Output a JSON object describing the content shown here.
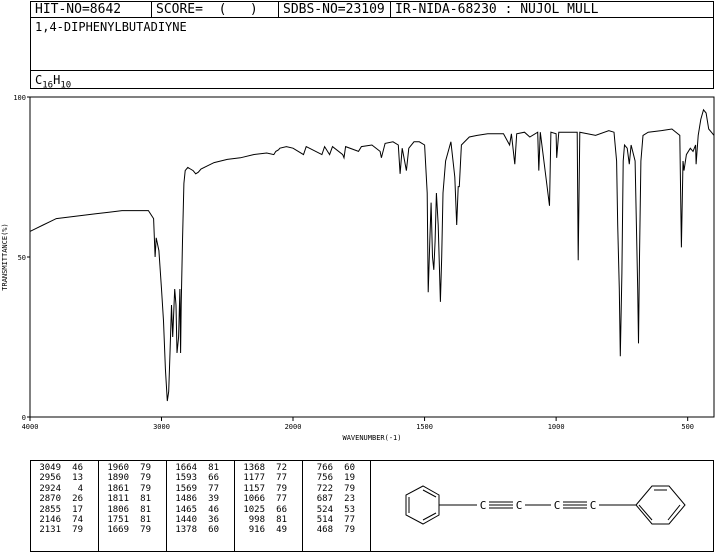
{
  "header": {
    "hit_no": "HIT-NO=8642",
    "score": "SCORE=  (   )",
    "sdbs_no": "SDBS-NO=23109",
    "ir_code": "IR-NIDA-68230 : NUJOL MULL"
  },
  "compound": {
    "name": "1,4-DIPHENYLBUTADIYNE",
    "formula_c": "C",
    "formula_c_sub": "16",
    "formula_h": "H",
    "formula_h_sub": "10"
  },
  "chart_data": {
    "type": "line",
    "xlabel": "WAVENUMBER(-1)",
    "ylabel": "TRANSMITTANCE(%)",
    "xlim": [
      4000,
      400
    ],
    "ylim": [
      0,
      100
    ],
    "x_ticks": [
      4000,
      3000,
      2000,
      1500,
      1000,
      500
    ],
    "y_ticks": [
      0,
      50,
      100
    ],
    "grid": false,
    "series": [
      {
        "points": [
          [
            4000,
            58
          ],
          [
            3950,
            59
          ],
          [
            3900,
            60
          ],
          [
            3850,
            61
          ],
          [
            3800,
            62
          ],
          [
            3700,
            62.5
          ],
          [
            3600,
            63
          ],
          [
            3500,
            63.5
          ],
          [
            3400,
            64
          ],
          [
            3300,
            64.5
          ],
          [
            3200,
            64.5
          ],
          [
            3100,
            64.5
          ],
          [
            3060,
            62
          ],
          [
            3049,
            50
          ],
          [
            3040,
            56
          ],
          [
            3020,
            52
          ],
          [
            3000,
            40
          ],
          [
            2985,
            30
          ],
          [
            2970,
            15
          ],
          [
            2956,
            5
          ],
          [
            2945,
            8
          ],
          [
            2935,
            20
          ],
          [
            2924,
            35
          ],
          [
            2915,
            25
          ],
          [
            2900,
            40
          ],
          [
            2890,
            35
          ],
          [
            2882,
            20
          ],
          [
            2870,
            25
          ],
          [
            2860,
            40
          ],
          [
            2855,
            20
          ],
          [
            2850,
            35
          ],
          [
            2840,
            55
          ],
          [
            2830,
            73
          ],
          [
            2820,
            77
          ],
          [
            2800,
            78
          ],
          [
            2780,
            77.5
          ],
          [
            2760,
            77
          ],
          [
            2740,
            76
          ],
          [
            2720,
            76.5
          ],
          [
            2700,
            77.5
          ],
          [
            2650,
            78.5
          ],
          [
            2600,
            79.5
          ],
          [
            2500,
            80.5
          ],
          [
            2400,
            81
          ],
          [
            2300,
            82
          ],
          [
            2200,
            82.5
          ],
          [
            2146,
            82
          ],
          [
            2131,
            83
          ],
          [
            2110,
            83.5
          ],
          [
            2100,
            84
          ],
          [
            2050,
            84.5
          ],
          [
            2000,
            84
          ],
          [
            1960,
            82
          ],
          [
            1950,
            84.5
          ],
          [
            1890,
            82
          ],
          [
            1880,
            84.5
          ],
          [
            1861,
            82
          ],
          [
            1850,
            84.5
          ],
          [
            1811,
            82
          ],
          [
            1806,
            81
          ],
          [
            1800,
            84.5
          ],
          [
            1751,
            83
          ],
          [
            1740,
            84.5
          ],
          [
            1700,
            85
          ],
          [
            1669,
            83
          ],
          [
            1664,
            81
          ],
          [
            1650,
            85.5
          ],
          [
            1620,
            86
          ],
          [
            1600,
            85
          ],
          [
            1593,
            76
          ],
          [
            1585,
            84
          ],
          [
            1569,
            77
          ],
          [
            1560,
            84
          ],
          [
            1540,
            86
          ],
          [
            1520,
            86
          ],
          [
            1500,
            85
          ],
          [
            1490,
            70
          ],
          [
            1486,
            39
          ],
          [
            1480,
            55
          ],
          [
            1475,
            67
          ],
          [
            1470,
            50
          ],
          [
            1465,
            46
          ],
          [
            1460,
            55
          ],
          [
            1455,
            70
          ],
          [
            1448,
            60
          ],
          [
            1440,
            36
          ],
          [
            1435,
            50
          ],
          [
            1430,
            70
          ],
          [
            1420,
            80
          ],
          [
            1400,
            86
          ],
          [
            1385,
            75
          ],
          [
            1378,
            60
          ],
          [
            1372,
            72
          ],
          [
            1368,
            72
          ],
          [
            1360,
            85
          ],
          [
            1330,
            87.5
          ],
          [
            1300,
            88
          ],
          [
            1260,
            88.5
          ],
          [
            1200,
            88.5
          ],
          [
            1177,
            85
          ],
          [
            1170,
            88.5
          ],
          [
            1157,
            79
          ],
          [
            1150,
            88.5
          ],
          [
            1120,
            89
          ],
          [
            1100,
            87.5
          ],
          [
            1070,
            89
          ],
          [
            1066,
            77
          ],
          [
            1060,
            89
          ],
          [
            1025,
            66
          ],
          [
            1020,
            89
          ],
          [
            1000,
            88.5
          ],
          [
            998,
            81
          ],
          [
            990,
            89
          ],
          [
            940,
            89
          ],
          [
            920,
            89
          ],
          [
            916,
            49
          ],
          [
            910,
            89
          ],
          [
            850,
            88
          ],
          [
            800,
            89.5
          ],
          [
            780,
            89
          ],
          [
            770,
            80
          ],
          [
            766,
            60
          ],
          [
            760,
            40
          ],
          [
            756,
            19
          ],
          [
            750,
            45
          ],
          [
            745,
            80
          ],
          [
            740,
            85
          ],
          [
            730,
            84
          ],
          [
            722,
            79
          ],
          [
            715,
            85
          ],
          [
            700,
            80
          ],
          [
            695,
            60
          ],
          [
            690,
            40
          ],
          [
            687,
            23
          ],
          [
            683,
            50
          ],
          [
            678,
            80
          ],
          [
            670,
            88
          ],
          [
            650,
            89
          ],
          [
            600,
            89.5
          ],
          [
            560,
            90
          ],
          [
            530,
            88
          ],
          [
            524,
            53
          ],
          [
            518,
            80
          ],
          [
            514,
            77
          ],
          [
            505,
            82
          ],
          [
            490,
            84
          ],
          [
            480,
            83
          ],
          [
            470,
            85
          ],
          [
            468,
            79
          ],
          [
            460,
            88
          ],
          [
            450,
            93
          ],
          [
            440,
            96
          ],
          [
            430,
            95
          ],
          [
            420,
            90
          ],
          [
            410,
            89
          ],
          [
            400,
            88
          ]
        ]
      }
    ]
  },
  "peaks": [
    [
      [
        "3049",
        "46"
      ],
      [
        "2956",
        "13"
      ],
      [
        "2924",
        "4"
      ],
      [
        "2870",
        "26"
      ],
      [
        "2855",
        "17"
      ],
      [
        "2146",
        "74"
      ],
      [
        "2131",
        "79"
      ]
    ],
    [
      [
        "1960",
        "79"
      ],
      [
        "1890",
        "79"
      ],
      [
        "1861",
        "79"
      ],
      [
        "1811",
        "81"
      ],
      [
        "1806",
        "81"
      ],
      [
        "1751",
        "81"
      ],
      [
        "1669",
        "79"
      ]
    ],
    [
      [
        "1664",
        "81"
      ],
      [
        "1593",
        "66"
      ],
      [
        "1569",
        "77"
      ],
      [
        "1486",
        "39"
      ],
      [
        "1465",
        "46"
      ],
      [
        "1440",
        "36"
      ],
      [
        "1378",
        "60"
      ]
    ],
    [
      [
        "1368",
        "72"
      ],
      [
        "1177",
        "77"
      ],
      [
        "1157",
        "79"
      ],
      [
        "1066",
        "77"
      ],
      [
        "1025",
        "66"
      ],
      [
        "998",
        "81"
      ],
      [
        "916",
        "49"
      ]
    ],
    [
      [
        "766",
        "60"
      ],
      [
        "756",
        "19"
      ],
      [
        "722",
        "79"
      ],
      [
        "687",
        "23"
      ],
      [
        "524",
        "53"
      ],
      [
        "514",
        "77"
      ],
      [
        "468",
        "79"
      ]
    ]
  ],
  "structure": {
    "atom_c1": "C",
    "atom_c2": "C",
    "atom_c3": "C",
    "atom_c4": "C"
  }
}
